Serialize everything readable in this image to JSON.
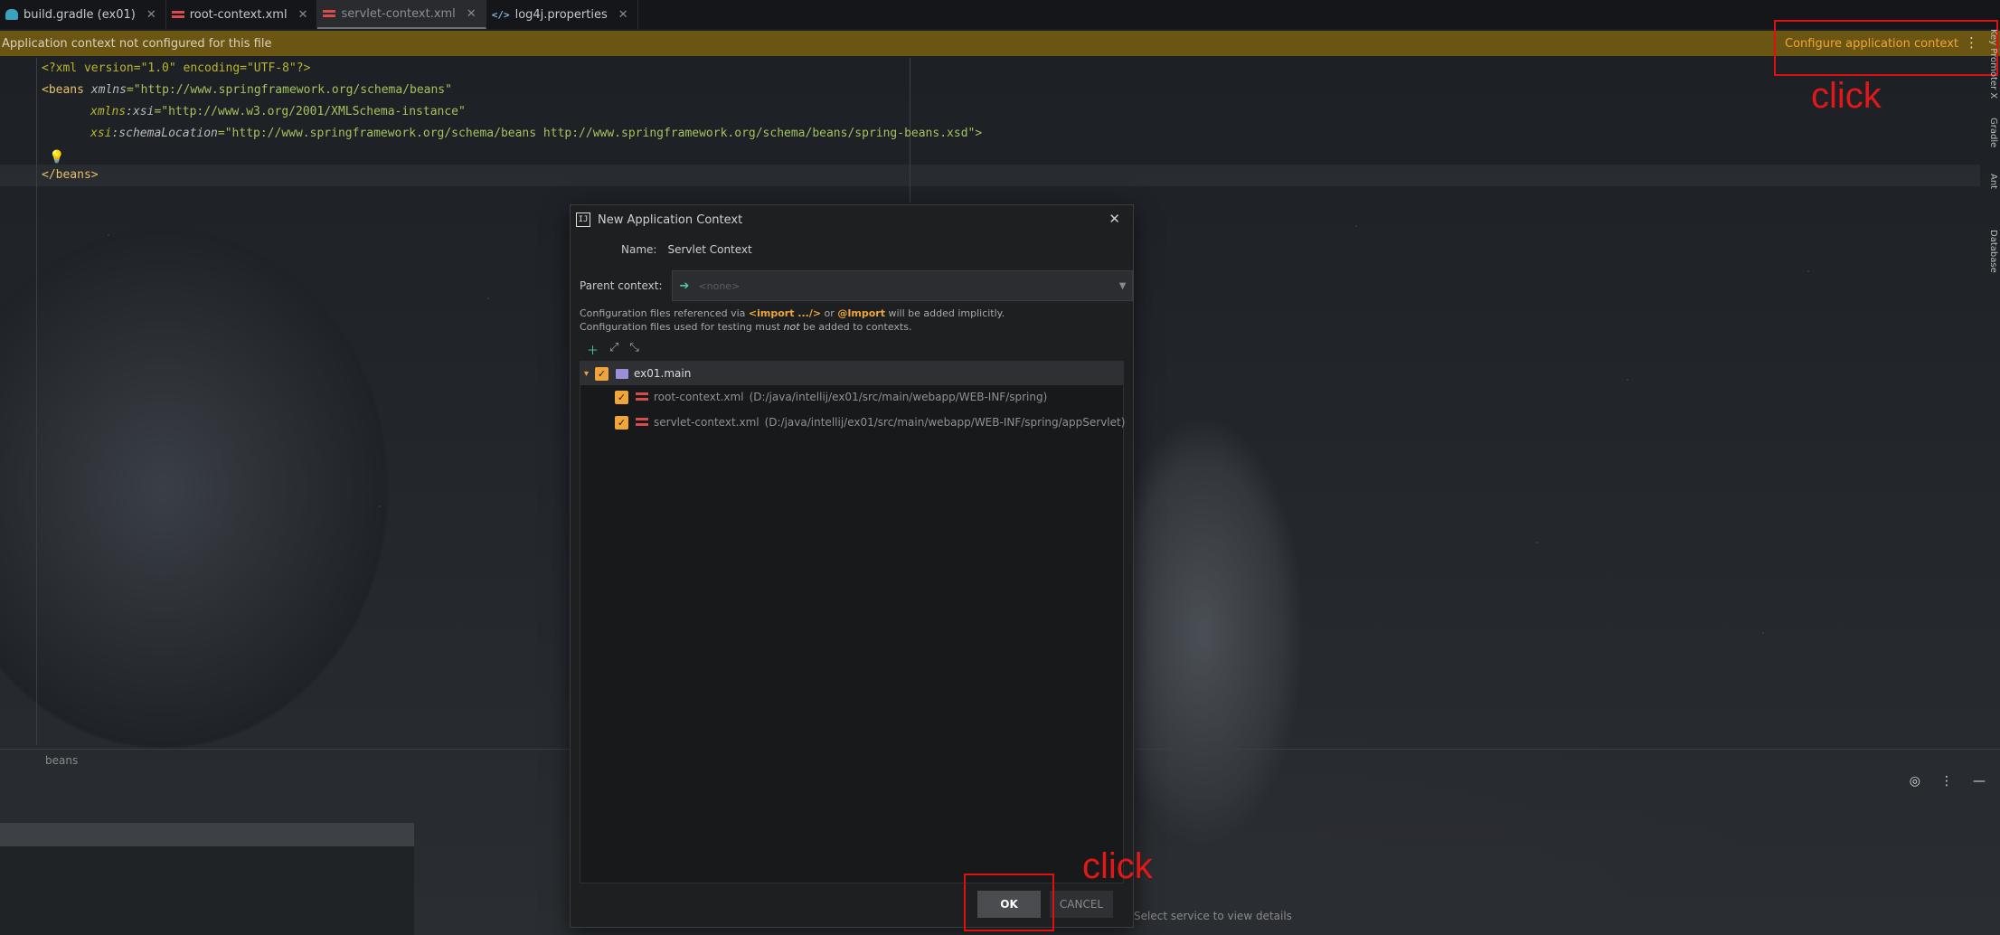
{
  "tabs": [
    {
      "label": "build.gradle (ex01)",
      "icon": "gradle-icon",
      "active": false
    },
    {
      "label": "root-context.xml",
      "icon": "spring-xml-icon",
      "active": false
    },
    {
      "label": "servlet-context.xml",
      "icon": "spring-xml-icon",
      "active": true
    },
    {
      "label": "log4j.properties",
      "icon": "properties-icon",
      "active": false
    }
  ],
  "banner": {
    "message": "Application context not configured for this file",
    "action": "Configure application context"
  },
  "annotations": {
    "click_top": "click",
    "click_ok": "click"
  },
  "code": {
    "line1_pi": "<?xml version=\"1.0\" encoding=\"UTF-8\"?>",
    "line2_tag": "<beans",
    "line2_attr": "xmlns",
    "line2_val": "=\"http://www.springframework.org/schema/beans\"",
    "line3_ns": "xmlns",
    "line3_attr": ":xsi",
    "line3_val": "=\"http://www.w3.org/2001/XMLSchema-instance\"",
    "line4_ns": "xsi",
    "line4_attr": ":schemaLocation",
    "line4_val": "=\"http://www.springframework.org/schema/beans http://www.springframework.org/schema/beans/spring-beans.xsd\">",
    "line6": "</beans>"
  },
  "breadcrumb": "beans",
  "select_service": "Select service to view details",
  "right_strip": [
    "Key Promoter X",
    "Gradle",
    "Ant",
    "Database"
  ],
  "dialog": {
    "title": "New Application Context",
    "name_label": "Name:",
    "name_value": "Servlet Context",
    "parent_label": "Parent context:",
    "parent_placeholder": "<none>",
    "info_line1_a": "Configuration files referenced via ",
    "info_line1_b": "<import .../>",
    "info_line1_c": " or ",
    "info_line1_d": "@Import",
    "info_line1_e": " will be added implicitly.",
    "info_line2_a": "Configuration files used for testing must ",
    "info_line2_b": "not",
    "info_line2_c": " be added to contexts.",
    "tree": {
      "root": "ex01.main",
      "children": [
        {
          "name": "root-context.xml",
          "path": "(D:/java/intellij/ex01/src/main/webapp/WEB-INF/spring)"
        },
        {
          "name": "servlet-context.xml",
          "path": "(D:/java/intellij/ex01/src/main/webapp/WEB-INF/spring/appServlet)"
        }
      ]
    },
    "ok": "OK",
    "cancel": "CANCEL"
  },
  "colors": {
    "accent": "#f0a53a",
    "banner": "#6b5512",
    "annotation": "#e01010"
  }
}
